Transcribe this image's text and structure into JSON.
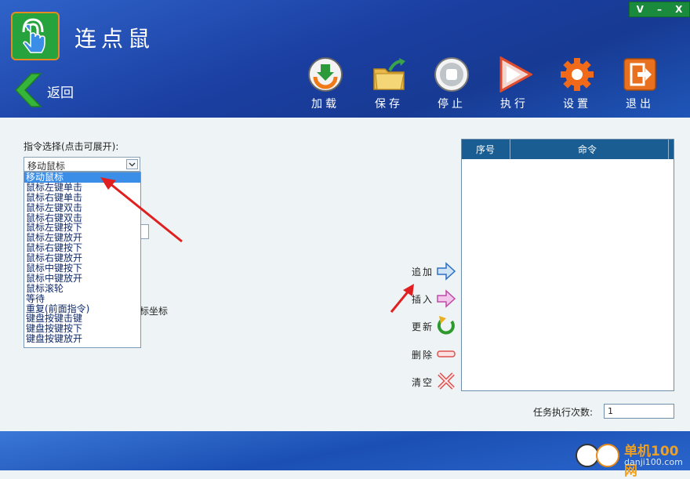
{
  "window_controls": {
    "min_v": "V",
    "minimize": "–",
    "close": "X"
  },
  "app": {
    "title": "连点鼠",
    "logo_icon": "hand-click-icon"
  },
  "nav": {
    "back_label": "返回",
    "back_icon": "chevron-left-icon"
  },
  "toolbar": [
    {
      "label": "加载",
      "icon": "load-icon"
    },
    {
      "label": "保存",
      "icon": "folder-save-icon"
    },
    {
      "label": "停止",
      "icon": "stop-icon"
    },
    {
      "label": "执行",
      "icon": "play-icon"
    },
    {
      "label": "设置",
      "icon": "gear-icon"
    },
    {
      "label": "退出",
      "icon": "exit-icon"
    }
  ],
  "command": {
    "label": "指令选择(点击可展开):",
    "selected": "移动鼠标",
    "options": [
      "移动鼠标",
      "鼠标左键单击",
      "鼠标右键单击",
      "鼠标左键双击",
      "鼠标右键双击",
      "鼠标左键按下",
      "鼠标左键放开",
      "鼠标右键按下",
      "鼠标右键放开",
      "鼠标中键按下",
      "鼠标中键放开",
      "鼠标滚轮",
      "等待",
      "重复(前面指令)",
      "键盘按键击键",
      "键盘按键按下",
      "键盘按键放开"
    ]
  },
  "partial_label": "标坐标",
  "list": {
    "col_index": "序号",
    "col_command": "命令"
  },
  "actions": {
    "add": "追加",
    "insert": "插入",
    "update": "更新",
    "delete": "删除",
    "clear": "清空"
  },
  "task": {
    "label": "任务执行次数:",
    "value": "1"
  },
  "watermark": {
    "brand": "单机100网",
    "url": "danji100.com"
  },
  "colors": {
    "accent": "#1a5d92",
    "header": "#1b3fa2",
    "arrow": "#e02020"
  }
}
